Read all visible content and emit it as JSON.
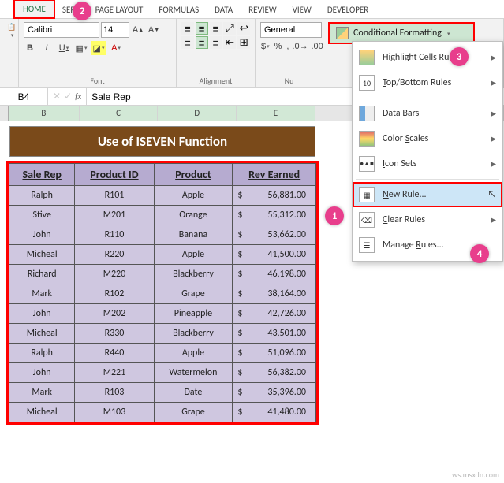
{
  "tabs": [
    "HOME",
    "SERT",
    "PAGE LAYOUT",
    "FORMULAS",
    "DATA",
    "REVIEW",
    "VIEW",
    "DEVELOPER"
  ],
  "font": {
    "name": "Calibri",
    "size": "14"
  },
  "group_labels": {
    "font": "Font",
    "align": "Alignment",
    "number": "Nu"
  },
  "number_format": "General",
  "cf_button": "Conditional Formatting",
  "namebox": "B4",
  "formula": "Sale Rep",
  "colheads": [
    "B",
    "C",
    "D",
    "E"
  ],
  "title": "Use of ISEVEN Function",
  "headers": [
    "Sale Rep",
    "Product ID",
    "Product",
    "Rev Earned"
  ],
  "rows": [
    [
      "Ralph",
      "R101",
      "Apple",
      "56,881.00"
    ],
    [
      "Stive",
      "M201",
      "Orange",
      "55,312.00"
    ],
    [
      "John",
      "R110",
      "Banana",
      "53,662.00"
    ],
    [
      "Micheal",
      "R220",
      "Apple",
      "41,500.00"
    ],
    [
      "Richard",
      "M220",
      "Blackberry",
      "46,198.00"
    ],
    [
      "Mark",
      "R102",
      "Grape",
      "38,164.00"
    ],
    [
      "John",
      "M202",
      "Pineapple",
      "42,726.00"
    ],
    [
      "Micheal",
      "R330",
      "Blackberry",
      "43,501.00"
    ],
    [
      "Ralph",
      "R440",
      "Apple",
      "51,096.00"
    ],
    [
      "John",
      "M221",
      "Watermelon",
      "56,382.00"
    ],
    [
      "Mark",
      "R103",
      "Date",
      "35,396.00"
    ],
    [
      "Micheal",
      "M103",
      "Grape",
      "41,480.00"
    ]
  ],
  "currency": "$",
  "menu": {
    "highlight": "Highlight Cells Rules",
    "topbottom": "Top/Bottom Rules",
    "databars": "Data Bars",
    "colorscales": "Color Scales",
    "iconsets": "Icon Sets",
    "newrule": "New Rule...",
    "clear": "Clear Rules",
    "manage": "Manage Rules..."
  },
  "callouts": {
    "c1": "1",
    "c2": "2",
    "c3": "3",
    "c4": "4"
  },
  "watermark": "ws.msxdn.com"
}
